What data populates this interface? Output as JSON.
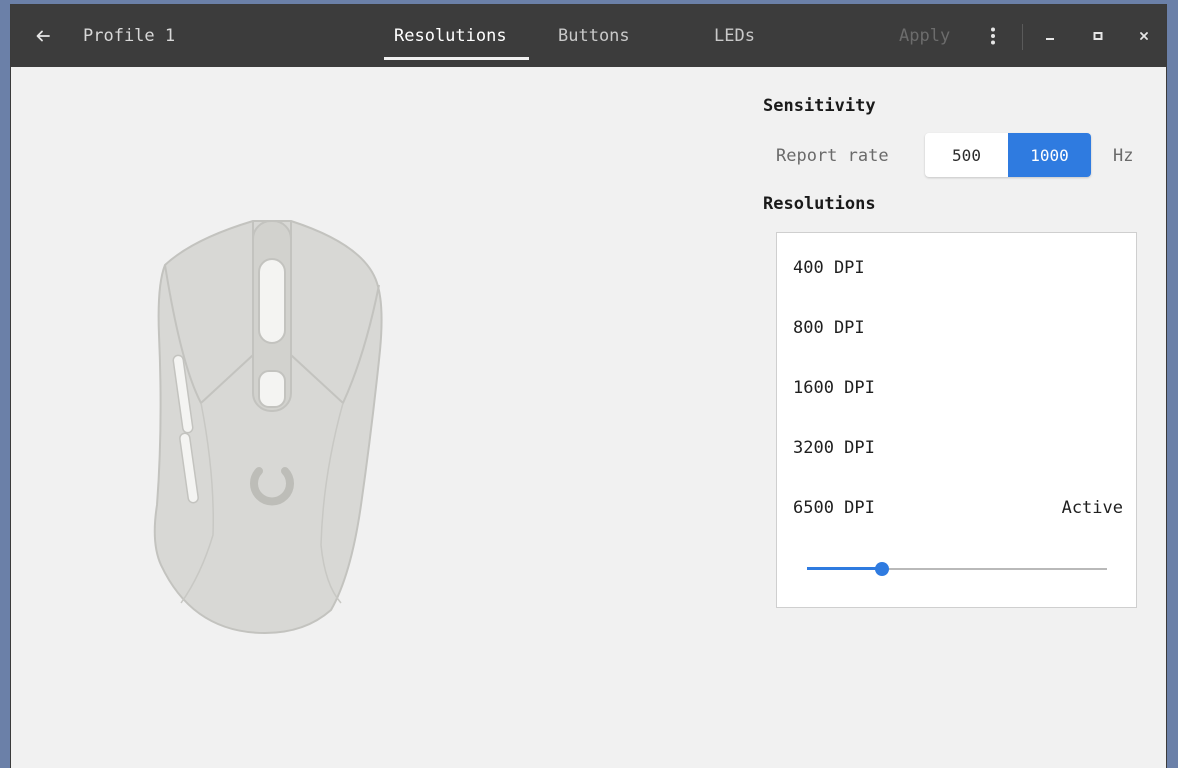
{
  "header": {
    "back_icon": "arrow-left-icon",
    "profile_label": "Profile 1",
    "tabs": [
      {
        "label": "Resolutions",
        "active": true
      },
      {
        "label": "Buttons",
        "active": false
      },
      {
        "label": "LEDs",
        "active": false
      }
    ],
    "apply_label": "Apply",
    "menu_icon": "kebab-vertical-icon",
    "window_controls": [
      "minimize-icon",
      "maximize-icon",
      "close-icon"
    ]
  },
  "sensitivity": {
    "title": "Sensitivity",
    "report_rate_label": "Report rate",
    "report_rate_options": [
      "500",
      "1000"
    ],
    "report_rate_selected": "1000",
    "unit": "Hz"
  },
  "resolutions": {
    "title": "Resolutions",
    "items": [
      {
        "label": "400 DPI",
        "state": ""
      },
      {
        "label": "800 DPI",
        "state": ""
      },
      {
        "label": "1600 DPI",
        "state": ""
      },
      {
        "label": "3200 DPI",
        "state": ""
      },
      {
        "label": "6500 DPI",
        "state": "Active"
      }
    ],
    "slider_value_fraction": 0.25
  },
  "colors": {
    "accent": "#2f7be0",
    "header_bg": "#3c3c3c",
    "content_bg": "#f1f1f1",
    "mouse_body": "#d8d8d5",
    "mouse_outline": "#c3c3bf"
  }
}
